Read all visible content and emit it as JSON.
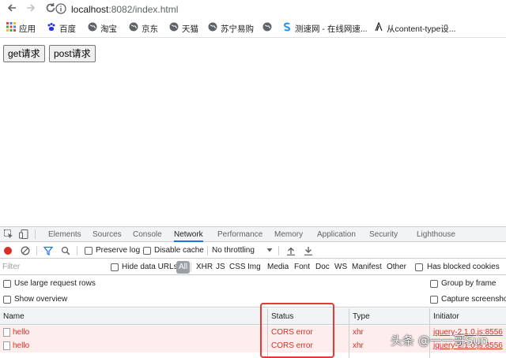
{
  "browser": {
    "url_host": "localhost",
    "url_rest": ":8082/index.html",
    "bookmarks": [
      "应用",
      "百度",
      "淘宝",
      "京东",
      "天猫",
      "苏宁易购",
      "",
      "测速网 - 在线网速...",
      "从content-type设..."
    ]
  },
  "page": {
    "get_button": "get请求",
    "post_button": "post请求"
  },
  "devtools": {
    "tabs": [
      "Elements",
      "Sources",
      "Console",
      "Network",
      "Performance",
      "Memory",
      "Application",
      "Security",
      "Lighthouse"
    ],
    "active_tab": "Network",
    "preserve_log": "Preserve log",
    "disable_cache": "Disable cache",
    "throttling": "No throttling",
    "filter_placeholder": "Filter",
    "hide_data_urls": "Hide data URLs",
    "types": [
      "All",
      "XHR",
      "JS",
      "CSS",
      "Img",
      "Media",
      "Font",
      "Doc",
      "WS",
      "Manifest",
      "Other"
    ],
    "has_blocked_cookies": "Has blocked cookies",
    "use_large_rows": "Use large request rows",
    "group_by_frame": "Group by frame",
    "show_overview": "Show overview",
    "capture_screenshots": "Capture screenshots",
    "columns": [
      "Name",
      "Status",
      "Type",
      "Initiator"
    ],
    "rows": [
      {
        "name": "hello",
        "status": "CORS error",
        "type": "xhr",
        "initiator": "jquery-2.1.0.js:8556"
      },
      {
        "name": "hello",
        "status": "CORS error",
        "type": "xhr",
        "initiator": "jquery-2.1.0.js:8556"
      }
    ]
  },
  "watermark": "头条 @一一哥Sun",
  "colors": {
    "accent": "#1a73e8",
    "error": "#d93025",
    "highlight": "#e53935"
  }
}
